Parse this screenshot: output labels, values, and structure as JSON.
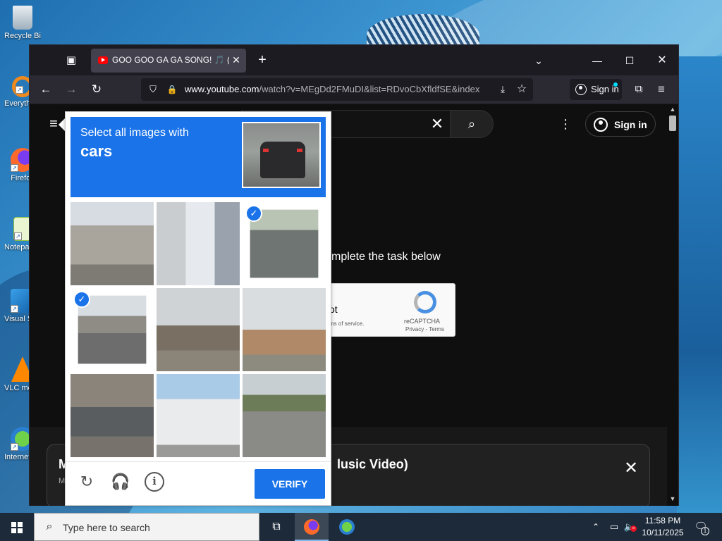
{
  "desktop": {
    "icons": [
      {
        "label": "Recycle Bin"
      },
      {
        "label": "Everything"
      },
      {
        "label": "Firefox"
      },
      {
        "label": "Notepad++"
      },
      {
        "label": "Visual Studio Code"
      },
      {
        "label": "VLC media player"
      },
      {
        "label": "Internet Download Manager"
      }
    ]
  },
  "browser": {
    "tab": {
      "title": "GOO GOO GA GA SONG! 🎵 (D"
    },
    "url": {
      "host": "www.youtube.com",
      "path": "/watch?v=MEgDd2FMuDI&list=RDvoCbXfldfSE&index"
    },
    "signin_label": "Sign in"
  },
  "youtube": {
    "signin_label": "Sign in",
    "task_text": "mplete the task below",
    "recaptcha": {
      "robot_text": "ot",
      "terms_text": "ms of service.",
      "label": "reCAPTCHA",
      "links": "Privacy - Terms"
    },
    "card": {
      "title": "M",
      "title_tail": "lusic Video)",
      "subtitle": "M"
    }
  },
  "captcha": {
    "prompt": "Select all images with",
    "target": "cars",
    "tiles": [
      {
        "scene": "building-street",
        "selected": false
      },
      {
        "scene": "office-intersection",
        "selected": false
      },
      {
        "scene": "road-with-cars",
        "selected": true
      },
      {
        "scene": "street-with-car",
        "selected": true
      },
      {
        "scene": "traffic-light-shops",
        "selected": false
      },
      {
        "scene": "traffic-light-palms",
        "selected": false
      },
      {
        "scene": "parked-cars-street",
        "selected": false
      },
      {
        "scene": "white-building",
        "selected": false
      },
      {
        "scene": "empty-highway",
        "selected": false
      }
    ],
    "verify_label": "VERIFY",
    "colors": {
      "accent": "#1a73e8"
    }
  },
  "taskbar": {
    "search_placeholder": "Type here to search",
    "time": "11:58 PM",
    "date": "10/11/2025",
    "notifications": "1"
  }
}
